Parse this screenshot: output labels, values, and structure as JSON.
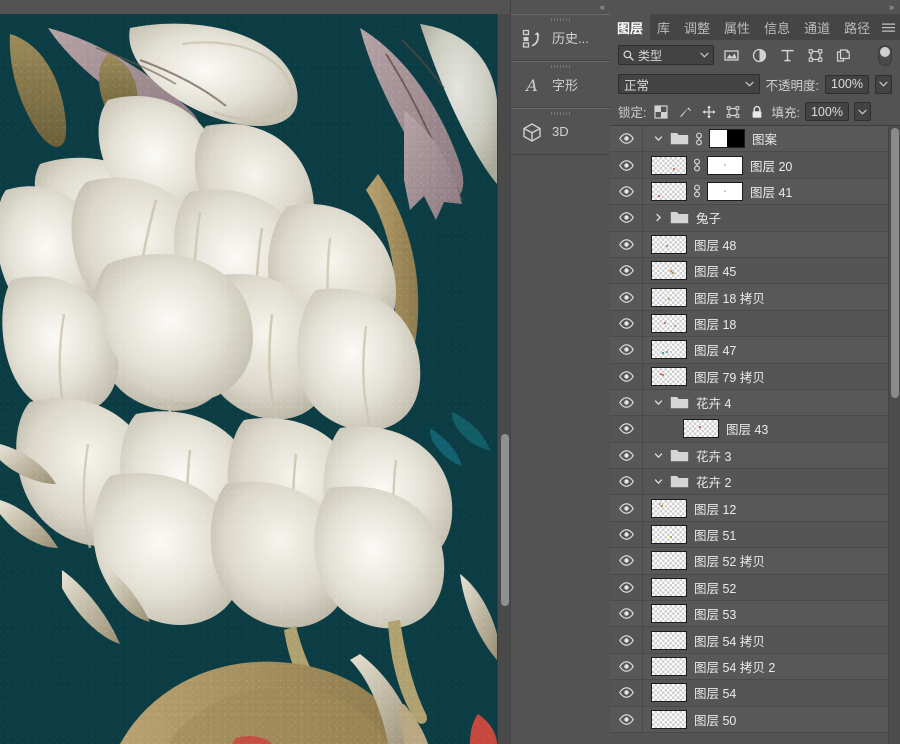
{
  "window": {
    "dock_collapse_left_label": "«",
    "dock_collapse_right_label": "»"
  },
  "icon_dock": {
    "tabs": [
      {
        "label": "历史...",
        "icon": "history-icon"
      },
      {
        "label": "字形",
        "icon": "glyphs-icon"
      },
      {
        "label": "3D",
        "icon": "cube-3d-icon"
      }
    ]
  },
  "panel": {
    "tabs": [
      {
        "label": "图层",
        "active": true
      },
      {
        "label": "库",
        "active": false
      },
      {
        "label": "调整",
        "active": false
      },
      {
        "label": "属性",
        "active": false
      },
      {
        "label": "信息",
        "active": false
      },
      {
        "label": "通道",
        "active": false
      },
      {
        "label": "路径",
        "active": false
      }
    ],
    "menu_icon": "hamburger-menu-icon",
    "filter": {
      "search_icon": "search-icon",
      "kind_label": "类型",
      "caret_icon": "chevron-down-icon",
      "type_filters": [
        {
          "name": "filter-pixel-icon"
        },
        {
          "name": "filter-adjustment-icon"
        },
        {
          "name": "filter-type-icon"
        },
        {
          "name": "filter-shape-icon"
        },
        {
          "name": "filter-smart-object-icon"
        }
      ],
      "toggle_icon": "filter-enable-toggle"
    },
    "blend": {
      "mode_value": "正常",
      "opacity_label": "不透明度:",
      "opacity_value": "100%"
    },
    "lock": {
      "label": "锁定:",
      "icons": [
        {
          "name": "lock-transparent-pixels-icon"
        },
        {
          "name": "lock-image-pixels-icon"
        },
        {
          "name": "lock-position-icon"
        },
        {
          "name": "lock-artboard-nesting-icon"
        },
        {
          "name": "lock-all-icon"
        }
      ],
      "fill_label": "填充:",
      "fill_value": "100%"
    },
    "layers": [
      {
        "name": "图案",
        "type": "group",
        "indent": 0,
        "expanded": true,
        "visible": true,
        "has_mask": true,
        "mask_style": "split",
        "has_link": true,
        "has_thumb": false
      },
      {
        "name": "图层 20",
        "type": "layer",
        "indent": 1,
        "expanded": null,
        "visible": true,
        "has_mask": true,
        "mask_style": "white",
        "has_link": true,
        "has_thumb": true
      },
      {
        "name": "图层 41",
        "type": "layer",
        "indent": 1,
        "expanded": null,
        "visible": true,
        "has_mask": true,
        "mask_style": "white",
        "has_link": true,
        "has_thumb": true
      },
      {
        "name": "兔子",
        "type": "group",
        "indent": 1,
        "expanded": false,
        "visible": true,
        "has_mask": false,
        "mask_style": "",
        "has_link": false,
        "has_thumb": false
      },
      {
        "name": "图层 48",
        "type": "layer",
        "indent": 1,
        "expanded": null,
        "visible": true,
        "has_mask": false,
        "mask_style": "",
        "has_link": false,
        "has_thumb": true
      },
      {
        "name": "图层 45",
        "type": "layer",
        "indent": 1,
        "expanded": null,
        "visible": true,
        "has_mask": false,
        "mask_style": "",
        "has_link": false,
        "has_thumb": true
      },
      {
        "name": "图层 18 拷贝",
        "type": "layer",
        "indent": 1,
        "expanded": null,
        "visible": true,
        "has_mask": false,
        "mask_style": "",
        "has_link": false,
        "has_thumb": true
      },
      {
        "name": "图层 18",
        "type": "layer",
        "indent": 1,
        "expanded": null,
        "visible": true,
        "has_mask": false,
        "mask_style": "",
        "has_link": false,
        "has_thumb": true
      },
      {
        "name": "图层 47",
        "type": "layer",
        "indent": 1,
        "expanded": null,
        "visible": true,
        "has_mask": false,
        "mask_style": "",
        "has_link": false,
        "has_thumb": true
      },
      {
        "name": "图层 79 拷贝",
        "type": "layer",
        "indent": 1,
        "expanded": null,
        "visible": true,
        "has_mask": false,
        "mask_style": "",
        "has_link": false,
        "has_thumb": true
      },
      {
        "name": "花卉 4",
        "type": "group",
        "indent": 1,
        "expanded": true,
        "visible": true,
        "has_mask": false,
        "mask_style": "",
        "has_link": false,
        "has_thumb": false
      },
      {
        "name": "图层 43",
        "type": "layer",
        "indent": 2,
        "expanded": null,
        "visible": true,
        "has_mask": false,
        "mask_style": "",
        "has_link": false,
        "has_thumb": true
      },
      {
        "name": "花卉 3",
        "type": "group",
        "indent": 1,
        "expanded": true,
        "visible": true,
        "has_mask": false,
        "mask_style": "",
        "has_link": false,
        "has_thumb": false
      },
      {
        "name": "花卉 2",
        "type": "group",
        "indent": 1,
        "expanded": true,
        "visible": true,
        "has_mask": false,
        "mask_style": "",
        "has_link": false,
        "has_thumb": false
      },
      {
        "name": "图层 12",
        "type": "layer",
        "indent": 1,
        "expanded": null,
        "visible": true,
        "has_mask": false,
        "mask_style": "",
        "has_link": false,
        "has_thumb": true
      },
      {
        "name": "图层 51",
        "type": "layer",
        "indent": 1,
        "expanded": null,
        "visible": true,
        "has_mask": false,
        "mask_style": "",
        "has_link": false,
        "has_thumb": true
      },
      {
        "name": "图层 52 拷贝",
        "type": "layer",
        "indent": 1,
        "expanded": null,
        "visible": true,
        "has_mask": false,
        "mask_style": "",
        "has_link": false,
        "has_thumb": true
      },
      {
        "name": "图层 52",
        "type": "layer",
        "indent": 1,
        "expanded": null,
        "visible": true,
        "has_mask": false,
        "mask_style": "",
        "has_link": false,
        "has_thumb": true
      },
      {
        "name": "图层 53",
        "type": "layer",
        "indent": 1,
        "expanded": null,
        "visible": true,
        "has_mask": false,
        "mask_style": "",
        "has_link": false,
        "has_thumb": true
      },
      {
        "name": "图层 54 拷贝",
        "type": "layer",
        "indent": 1,
        "expanded": null,
        "visible": true,
        "has_mask": false,
        "mask_style": "",
        "has_link": false,
        "has_thumb": true
      },
      {
        "name": "图层 54 拷贝 2",
        "type": "layer",
        "indent": 1,
        "expanded": null,
        "visible": true,
        "has_mask": false,
        "mask_style": "",
        "has_link": false,
        "has_thumb": true
      },
      {
        "name": "图层 54",
        "type": "layer",
        "indent": 1,
        "expanded": null,
        "visible": true,
        "has_mask": false,
        "mask_style": "",
        "has_link": false,
        "has_thumb": true
      },
      {
        "name": "图层 50",
        "type": "layer",
        "indent": 1,
        "expanded": null,
        "visible": true,
        "has_mask": false,
        "mask_style": "",
        "has_link": false,
        "has_thumb": true
      }
    ]
  },
  "document": {
    "artwork_description": "白色牡丹插画",
    "colors": {
      "background": "#0d3d44",
      "petal_light": "#f2f0e8",
      "petal_mid": "#d8d4c6",
      "petal_shadow": "#b9b4a3",
      "vein": "#cdc3ae",
      "leaf_mauve": "#9e8a90",
      "leaf_olive": "#8a7a52",
      "stem_gold": "#a8915f",
      "accent_red": "#c6493f"
    }
  }
}
